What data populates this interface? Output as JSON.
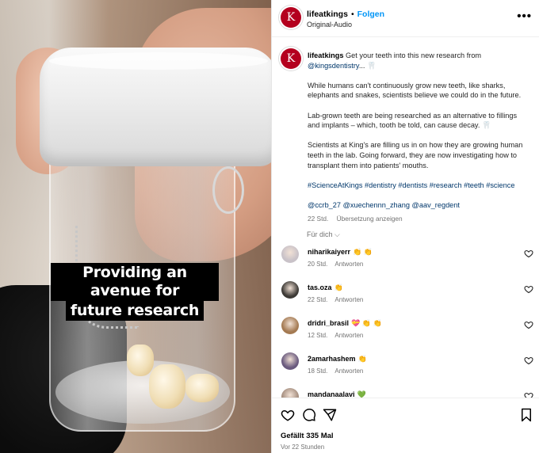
{
  "media": {
    "caption_line1": "Providing an avenue for",
    "caption_line2": "future research"
  },
  "header": {
    "avatar_letter": "K",
    "username": "lifeatkings",
    "separator": "•",
    "follow_label": "Folgen",
    "audio": "Original-Audio",
    "more_icon": "more-horizontal-icon"
  },
  "post": {
    "avatar_letter": "K",
    "username": "lifeatkings",
    "intro": "Get your teeth into this new research from",
    "mention_main": "@kingsdentistry",
    "intro_tail": "... 🦷",
    "para1": "While humans can't continuously grow new teeth, like sharks, elephants and snakes, scientists believe we could do in the future.",
    "para2": "Lab-grown teeth are being researched as an alternative to fillings and implants – which, tooth be told, can cause decay. 🦷",
    "para3": "Scientists at King's are filling us in on how they are growing human teeth in the lab. Going forward, they are now investigating how to transplant them into patients' mouths.",
    "hashtags": "#ScienceAtKings #dentistry #dentists #research #teeth #science",
    "mentions": "@ccrb_27 @xuechennn_zhang @aav_regdent",
    "age": "22 Std.",
    "translate": "Übersetzung anzeigen",
    "for_you": "Für dich ⌵"
  },
  "comments": [
    {
      "user": "niharikaiyerr",
      "emoji": "👏 👏",
      "age": "20 Std.",
      "reply": "Antworten",
      "avatar_color": "#c9c2c8"
    },
    {
      "user": "tas.oza",
      "emoji": "👏",
      "age": "22 Std.",
      "reply": "Antworten",
      "avatar_color": "#3d3a36"
    },
    {
      "user": "dridri_brasil",
      "emoji": "💝 👏 👏",
      "age": "12 Std.",
      "reply": "Antworten",
      "avatar_color": "#a47a52"
    },
    {
      "user": "2amarhashem",
      "emoji": "👏",
      "age": "18 Std.",
      "reply": "Antworten",
      "avatar_color": "#6a5a7e"
    },
    {
      "user": "mandanaalavi",
      "emoji": "💚",
      "age": "",
      "reply": "",
      "avatar_color": "#a68f80"
    }
  ],
  "footer": {
    "likes": "Gefällt 335 Mal",
    "ago": "Vor 22 Stunden",
    "icons": [
      "heart-icon",
      "comment-icon",
      "share-icon",
      "bookmark-icon"
    ]
  },
  "colors": {
    "accent": "#0095f6",
    "brand": "#b4001e",
    "link": "#00376b",
    "muted": "#737373"
  }
}
